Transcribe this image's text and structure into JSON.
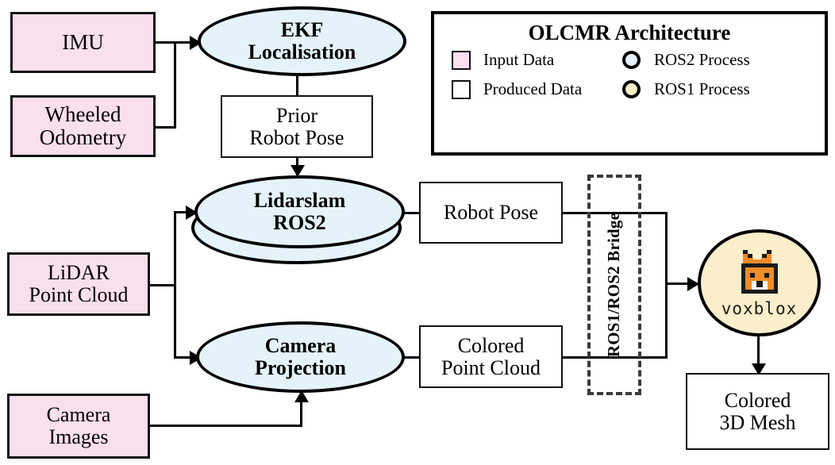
{
  "diagram": {
    "title": "OLCMR Architecture",
    "type": "system-architecture-flow"
  },
  "legend": {
    "title": "OLCMR Architecture",
    "entries": [
      {
        "swatch": "square-pink",
        "label": "Input Data",
        "color": "#fadfec"
      },
      {
        "swatch": "circle-blue",
        "label": "ROS2 Process",
        "color": "#e4f3f9"
      },
      {
        "swatch": "square-white",
        "label": "Produced Data",
        "color": "#ffffff"
      },
      {
        "swatch": "circle-cream",
        "label": "ROS1 Process",
        "color": "#fbeecb"
      }
    ]
  },
  "nodes": {
    "imu": "IMU",
    "wheeled_odometry": "Wheeled\nOdometry",
    "ekf_localisation": "EKF\nLocalisation",
    "prior_robot_pose": "Prior\nRobot Pose",
    "lidarslam_ros2": "Lidarslam\nROS2",
    "lidar_point_cloud": "LiDAR\nPoint Cloud",
    "camera_projection": "Camera\nProjection",
    "camera_images": "Camera\nImages",
    "robot_pose": "Robot Pose",
    "colored_point_cloud": "Colored\nPoint Cloud",
    "ros_bridge": "ROS1/ROS2\nBridge",
    "voxblox": "voxblox",
    "colored_3d_mesh": "Colored\n3D Mesh"
  },
  "edges": [
    {
      "from": "imu",
      "to": "ekf_localisation"
    },
    {
      "from": "wheeled_odometry",
      "to": "ekf_localisation"
    },
    {
      "from": "ekf_localisation",
      "to": "prior_robot_pose"
    },
    {
      "from": "prior_robot_pose",
      "to": "lidarslam_ros2"
    },
    {
      "from": "lidar_point_cloud",
      "to": "lidarslam_ros2"
    },
    {
      "from": "lidar_point_cloud",
      "to": "camera_projection"
    },
    {
      "from": "camera_images",
      "to": "camera_projection"
    },
    {
      "from": "lidarslam_ros2",
      "to": "robot_pose"
    },
    {
      "from": "camera_projection",
      "to": "colored_point_cloud"
    },
    {
      "from": "robot_pose",
      "to": "voxblox",
      "via": "ros_bridge"
    },
    {
      "from": "colored_point_cloud",
      "to": "voxblox",
      "via": "ros_bridge"
    },
    {
      "from": "voxblox",
      "to": "colored_3d_mesh"
    }
  ],
  "colors": {
    "input_data": "#fadfec",
    "produced_data": "#ffffff",
    "ros2_process": "#e4f3f9",
    "ros1_process": "#fbeecb",
    "stroke": "#000000",
    "fox_orange": "#f08c28",
    "fox_dark": "#1a1a1a"
  }
}
